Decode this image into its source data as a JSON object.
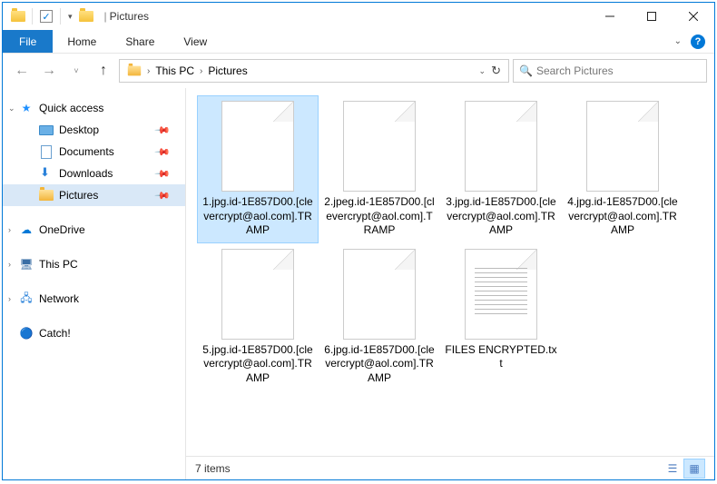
{
  "title": {
    "folder_name": "Pictures",
    "separator": "|"
  },
  "window_controls": {
    "min": "minimize",
    "max": "maximize",
    "close": "close"
  },
  "ribbon": {
    "file": "File",
    "tabs": [
      "Home",
      "Share",
      "View"
    ]
  },
  "breadcrumb": {
    "items": [
      "This PC",
      "Pictures"
    ]
  },
  "search": {
    "placeholder": "Search Pictures"
  },
  "sidebar": {
    "quick_access": "Quick access",
    "quick_items": [
      {
        "label": "Desktop",
        "pinned": true
      },
      {
        "label": "Documents",
        "pinned": true
      },
      {
        "label": "Downloads",
        "pinned": true
      },
      {
        "label": "Pictures",
        "pinned": true,
        "selected": true
      }
    ],
    "onedrive": "OneDrive",
    "thispc": "This PC",
    "network": "Network",
    "catch": "Catch!"
  },
  "files": [
    {
      "name": "1.jpg.id-1E857D00.[clevercrypt@aol.com].TRAMP",
      "type": "blank",
      "selected": true
    },
    {
      "name": "2.jpeg.id-1E857D00.[clevercrypt@aol.com].TRAMP",
      "type": "blank"
    },
    {
      "name": "3.jpg.id-1E857D00.[clevercrypt@aol.com].TRAMP",
      "type": "blank"
    },
    {
      "name": "4.jpg.id-1E857D00.[clevercrypt@aol.com].TRAMP",
      "type": "blank"
    },
    {
      "name": "5.jpg.id-1E857D00.[clevercrypt@aol.com].TRAMP",
      "type": "blank"
    },
    {
      "name": "6.jpg.id-1E857D00.[clevercrypt@aol.com].TRAMP",
      "type": "blank"
    },
    {
      "name": "FILES ENCRYPTED.txt",
      "type": "txt"
    }
  ],
  "status": {
    "count_label": "7 items"
  }
}
